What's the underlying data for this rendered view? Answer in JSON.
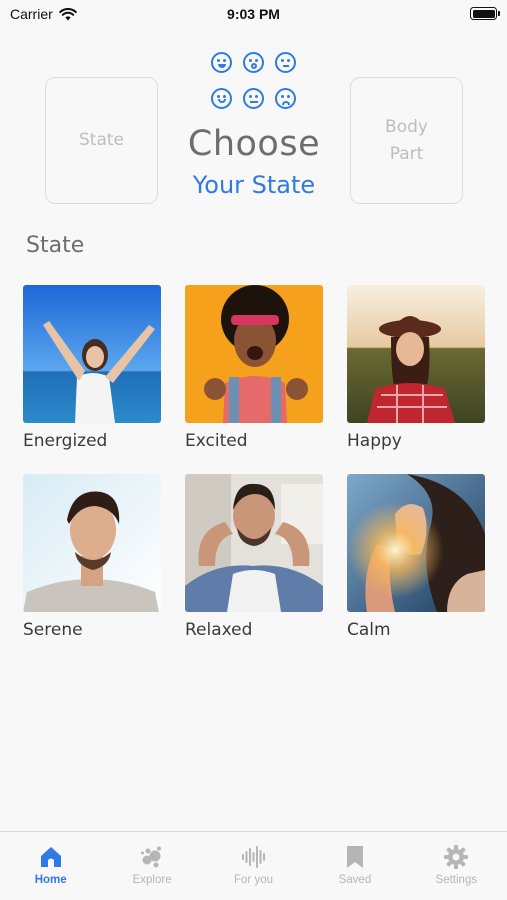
{
  "status_bar": {
    "carrier": "Carrier",
    "time": "9:03 PM"
  },
  "header": {
    "left_card": "State",
    "right_card": "Body Part",
    "title": "Choose",
    "subtitle": "Your State",
    "emoji_icons": [
      "laughing-face",
      "surprised-face",
      "neutral-face",
      "smiling-face",
      "blank-face",
      "sad-face"
    ]
  },
  "section": {
    "title": "State"
  },
  "states": [
    {
      "label": "Energized",
      "image": "woman-arms-raised-beach"
    },
    {
      "label": "Excited",
      "image": "excited-woman-orange-background"
    },
    {
      "label": "Happy",
      "image": "smiling-woman-hat-field"
    },
    {
      "label": "Serene",
      "image": "man-eyes-closed-sky"
    },
    {
      "label": "Relaxed",
      "image": "man-hands-behind-head"
    },
    {
      "label": "Calm",
      "image": "woman-praying-sunlight"
    }
  ],
  "tabbar": {
    "items": [
      {
        "label": "Home",
        "icon": "home-icon",
        "active": true
      },
      {
        "label": "Explore",
        "icon": "explore-icon",
        "active": false
      },
      {
        "label": "For you",
        "icon": "waveform-icon",
        "active": false
      },
      {
        "label": "Saved",
        "icon": "bookmark-icon",
        "active": false
      },
      {
        "label": "Settings",
        "icon": "gear-icon",
        "active": false
      }
    ]
  },
  "colors": {
    "accent": "#2f7ae5",
    "background": "#f8f8f8",
    "inactive": "#b5b5b5"
  }
}
